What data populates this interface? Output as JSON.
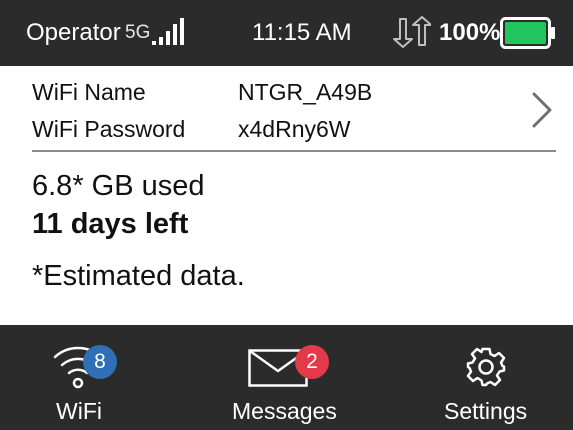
{
  "status_bar": {
    "operator": "Operator",
    "network": "5G",
    "time": "11:15 AM",
    "battery_percent": "100%"
  },
  "wifi": {
    "name_label": "WiFi Name",
    "name_value": "NTGR_A49B",
    "password_label": "WiFi Password",
    "password_value": "x4dRny6W"
  },
  "usage": {
    "data_used": "6.8* GB used",
    "days_left": "11 days left",
    "note": "*Estimated data."
  },
  "nav": {
    "wifi": {
      "label": "WiFi",
      "badge": "8"
    },
    "messages": {
      "label": "Messages",
      "badge": "2"
    },
    "settings": {
      "label": "Settings"
    }
  },
  "colors": {
    "bar_background": "#2b2b2b",
    "battery_fill": "#22c55e",
    "wifi_badge": "#2f6fb5",
    "messages_badge": "#e33a4a",
    "divider": "#8a8a8a"
  },
  "icons": [
    "signal-bars-icon",
    "data-transfer-icon",
    "battery-icon",
    "chevron-right-icon",
    "wifi-icon",
    "envelope-icon",
    "gear-icon"
  ]
}
